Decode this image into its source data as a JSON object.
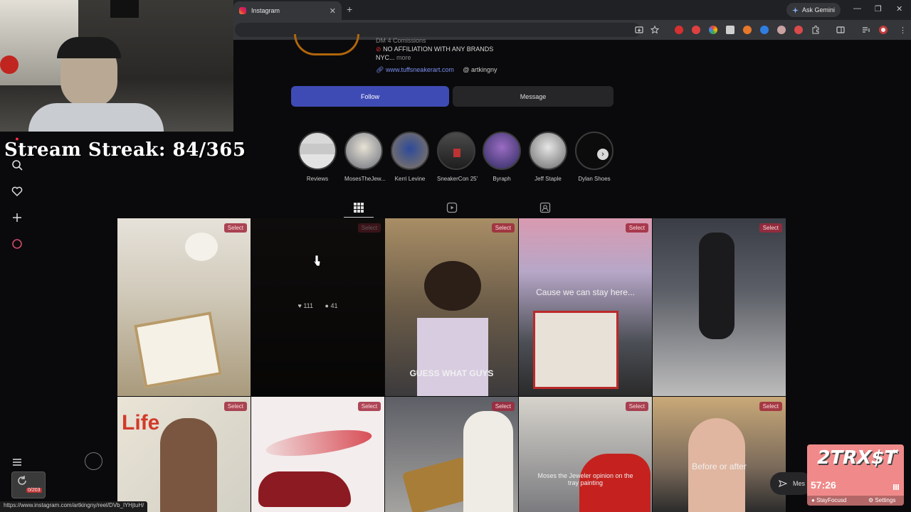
{
  "browser": {
    "tab_title": "Instagram",
    "tab_close": "✕",
    "new_tab": "+",
    "ask_gemini": "Ask Gemini",
    "status_url": "https://www.instagram.com/artkingny/reel/DVb_lYHjtuH/"
  },
  "profile": {
    "bio_line1": "DM 4 Comissions",
    "bio_line2": "NO AFFILIATION WITH ANY BRANDS",
    "bio_line3": "NYC...",
    "bio_more": "more",
    "website": "www.tuffsneakerart.com",
    "threads_handle": "artkingny",
    "follow_label": "Follow",
    "message_label": "Message"
  },
  "highlights": [
    {
      "label": "Reviews"
    },
    {
      "label": "MosesTheJew..."
    },
    {
      "label": "Kerri Levine"
    },
    {
      "label": "SneakerCon 25'"
    },
    {
      "label": "Byraph"
    },
    {
      "label": "Jeff Staple"
    },
    {
      "label": "Dylan Shoes"
    }
  ],
  "posts": {
    "select_label": "Select",
    "hover_likes": "111",
    "hover_comments": "41",
    "captions": {
      "p3": "GUESS WHAT GUYS",
      "p4": "Cause we can stay here...",
      "p9": "Moses the Jeweler opinion on the tray painting",
      "p10": "Before or after"
    }
  },
  "overlay": {
    "stream_streak": "Stream Streak: 84/365",
    "rec_counter": "0/203",
    "timer_logo": "2TRX$T",
    "timer_time": "57:26",
    "timer_app": "StayFocusd",
    "timer_settings": "Settings",
    "messages_label": "Mes"
  }
}
